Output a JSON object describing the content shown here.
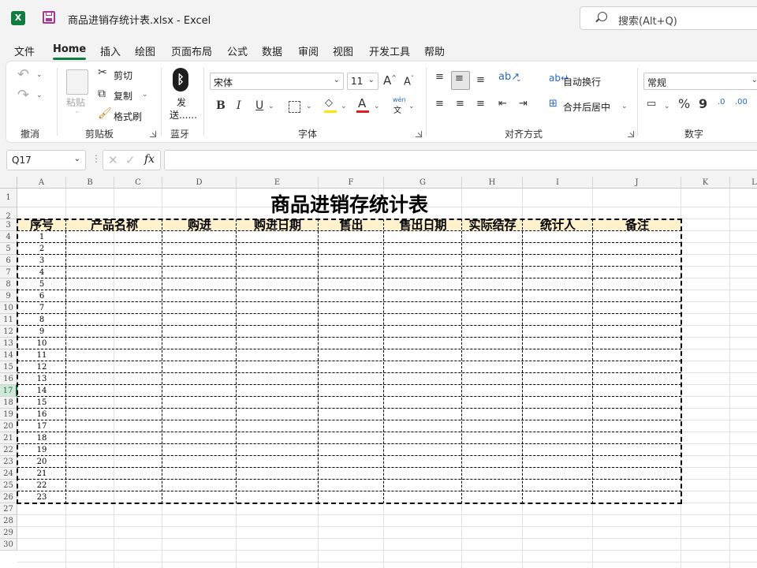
{
  "app": {
    "logo": "X",
    "document_title": "商品进销存统计表.xlsx  -  Excel",
    "search_placeholder": "搜索(Alt+Q)"
  },
  "menu": {
    "tabs": [
      "文件",
      "Home",
      "插入",
      "绘图",
      "页面布局",
      "公式",
      "数据",
      "审阅",
      "视图",
      "开发工具",
      "帮助"
    ],
    "active": "Home"
  },
  "ribbon": {
    "groups": {
      "undo": "撤消",
      "clipboard": "剪贴板",
      "bluetooth": "蓝牙",
      "font": "字体",
      "alignment": "对齐方式",
      "number": "数字"
    },
    "clipboard": {
      "paste": "粘贴",
      "cut": "剪切",
      "copy": "复制",
      "format_painter": "格式刷"
    },
    "bluetooth": {
      "send_line1": "发",
      "send_line2": "送......"
    },
    "font": {
      "family": "宋体",
      "size": "11",
      "grow": "A",
      "shrink": "A",
      "bold": "B",
      "italic": "I",
      "underline": "U",
      "font_color_letter": "A",
      "phonetic_top": "wén",
      "phonetic_bottom": "文",
      "fill_color": "#ffe600",
      "font_color": "#e01e1e"
    },
    "alignment": {
      "wrap_text": "自动换行",
      "merge_center": "合并后居中"
    },
    "number": {
      "format": "常规",
      "percent": "%",
      "comma": "9",
      "inc_decimal": ".0",
      "dec_decimal": ".00"
    }
  },
  "formula_bar": {
    "name_box": "Q17",
    "fx": "fx",
    "value": ""
  },
  "sheet": {
    "columns": [
      "A",
      "B",
      "C",
      "D",
      "E",
      "F",
      "G",
      "H",
      "I",
      "J",
      "K",
      "L"
    ],
    "rows": [
      "1",
      "2",
      "3",
      "4",
      "5",
      "6",
      "7",
      "8",
      "9",
      "10",
      "11",
      "12",
      "13",
      "14",
      "15",
      "16",
      "17",
      "18",
      "19",
      "20",
      "21",
      "22",
      "23",
      "24",
      "25",
      "26",
      "27",
      "28",
      "29",
      "30"
    ],
    "active_row": "17",
    "title": "商品进销存统计表",
    "headers": [
      "序号",
      "产品名称",
      "购进",
      "购进日期",
      "售出",
      "售出日期",
      "实际结存",
      "统计人",
      "备注"
    ],
    "header_fill": "#fff2cc",
    "serials": [
      "1",
      "2",
      "3",
      "4",
      "5",
      "6",
      "7",
      "8",
      "9",
      "10",
      "11",
      "12",
      "13",
      "14",
      "15",
      "16",
      "17",
      "18",
      "19",
      "20",
      "21",
      "22",
      "23"
    ]
  }
}
